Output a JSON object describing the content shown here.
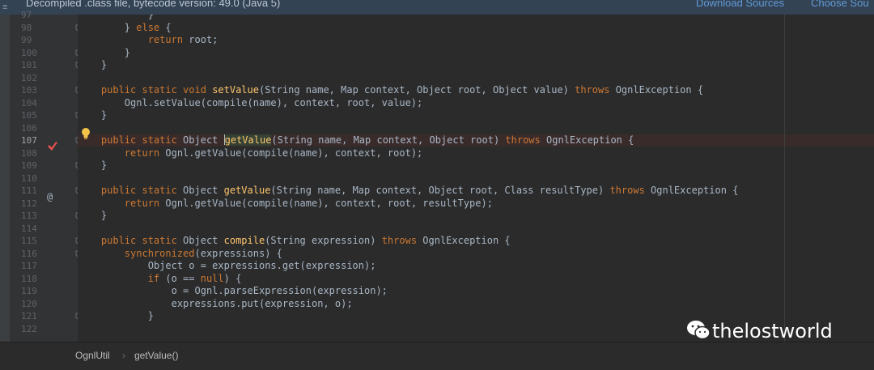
{
  "banner": {
    "title": "Decompiled .class file, bytecode version: 49.0 (Java 5)",
    "download_sources": "Download Sources",
    "choose_sources": "Choose Sou"
  },
  "editor": {
    "lines": [
      {
        "n": "97",
        "segs": [
          {
            "t": "            }",
            "c": "p"
          }
        ]
      },
      {
        "n": "98",
        "segs": [
          {
            "t": "        } ",
            "c": "p"
          },
          {
            "t": "else",
            "c": "kw"
          },
          {
            "t": " {",
            "c": "p"
          }
        ]
      },
      {
        "n": "99",
        "segs": [
          {
            "t": "            ",
            "c": "p"
          },
          {
            "t": "return",
            "c": "kw"
          },
          {
            "t": " root;",
            "c": "p"
          }
        ]
      },
      {
        "n": "100",
        "segs": [
          {
            "t": "        }",
            "c": "p"
          }
        ]
      },
      {
        "n": "101",
        "segs": [
          {
            "t": "    }",
            "c": "p"
          }
        ]
      },
      {
        "n": "102",
        "segs": []
      },
      {
        "n": "103",
        "segs": [
          {
            "t": "    ",
            "c": "p"
          },
          {
            "t": "public static void",
            "c": "kw"
          },
          {
            "t": " ",
            "c": "p"
          },
          {
            "t": "setValue",
            "c": "fn"
          },
          {
            "t": "(String name, Map context, Object root, Object value) ",
            "c": "p"
          },
          {
            "t": "throws",
            "c": "kw"
          },
          {
            "t": " OgnlException {",
            "c": "p"
          }
        ]
      },
      {
        "n": "104",
        "segs": [
          {
            "t": "        Ognl.setValue(compile(name), context, root, value);",
            "c": "p"
          }
        ]
      },
      {
        "n": "105",
        "segs": [
          {
            "t": "    }",
            "c": "p"
          }
        ]
      },
      {
        "n": "106",
        "segs": []
      },
      {
        "n": "107",
        "hl": true,
        "segs": [
          {
            "t": "    ",
            "c": "p"
          },
          {
            "t": "public static",
            "c": "kw"
          },
          {
            "t": " Object ",
            "c": "p"
          },
          {
            "t": "caret",
            "c": "caret"
          },
          {
            "t": "getValue",
            "c": "cur"
          },
          {
            "t": "(String name, Map context, Object root) ",
            "c": "p"
          },
          {
            "t": "throws",
            "c": "kw"
          },
          {
            "t": " OgnlException {",
            "c": "p"
          }
        ]
      },
      {
        "n": "108",
        "segs": [
          {
            "t": "        ",
            "c": "p"
          },
          {
            "t": "return",
            "c": "kw"
          },
          {
            "t": " Ognl.getValue(compile(name), context, root);",
            "c": "p"
          }
        ]
      },
      {
        "n": "109",
        "segs": [
          {
            "t": "    }",
            "c": "p"
          }
        ]
      },
      {
        "n": "110",
        "segs": []
      },
      {
        "n": "111",
        "segs": [
          {
            "t": "    ",
            "c": "p"
          },
          {
            "t": "public static",
            "c": "kw"
          },
          {
            "t": " Object ",
            "c": "p"
          },
          {
            "t": "getValue",
            "c": "fn"
          },
          {
            "t": "(String name, Map context, Object root, Class resultType) ",
            "c": "p"
          },
          {
            "t": "throws",
            "c": "kw"
          },
          {
            "t": " OgnlException {",
            "c": "p"
          }
        ]
      },
      {
        "n": "112",
        "segs": [
          {
            "t": "        ",
            "c": "p"
          },
          {
            "t": "return",
            "c": "kw"
          },
          {
            "t": " Ognl.getValue(compile(name), context, root, resultType);",
            "c": "p"
          }
        ]
      },
      {
        "n": "113",
        "segs": [
          {
            "t": "    }",
            "c": "p"
          }
        ]
      },
      {
        "n": "114",
        "segs": []
      },
      {
        "n": "115",
        "segs": [
          {
            "t": "    ",
            "c": "p"
          },
          {
            "t": "public static",
            "c": "kw"
          },
          {
            "t": " Object ",
            "c": "p"
          },
          {
            "t": "compile",
            "c": "fn"
          },
          {
            "t": "(String expression) ",
            "c": "p"
          },
          {
            "t": "throws",
            "c": "kw"
          },
          {
            "t": " OgnlException {",
            "c": "p"
          }
        ]
      },
      {
        "n": "116",
        "segs": [
          {
            "t": "        ",
            "c": "p"
          },
          {
            "t": "synchronized",
            "c": "kw"
          },
          {
            "t": "(expressions) {",
            "c": "p"
          }
        ]
      },
      {
        "n": "117",
        "segs": [
          {
            "t": "            Object o = expressions.get(expression);",
            "c": "p"
          }
        ]
      },
      {
        "n": "118",
        "segs": [
          {
            "t": "            ",
            "c": "p"
          },
          {
            "t": "if",
            "c": "kw"
          },
          {
            "t": " (o == ",
            "c": "p"
          },
          {
            "t": "null",
            "c": "kw"
          },
          {
            "t": ") {",
            "c": "p"
          }
        ]
      },
      {
        "n": "119",
        "segs": [
          {
            "t": "                o = Ognl.parseExpression(expression);",
            "c": "p"
          }
        ]
      },
      {
        "n": "120",
        "segs": [
          {
            "t": "                expressions.put(expression, o);",
            "c": "p"
          }
        ]
      },
      {
        "n": "121",
        "segs": [
          {
            "t": "            }",
            "c": "p"
          }
        ]
      },
      {
        "n": "122",
        "segs": []
      }
    ]
  },
  "gutter": {
    "override_marker": "@"
  },
  "status": {
    "class_name": "OgnlUtil",
    "method_name": "getValue()"
  },
  "watermark": {
    "text": "thelostworld"
  },
  "colors": {
    "keyword": "#cc7832",
    "function": "#ffc66d",
    "plain": "#a9b7c6",
    "background": "#2b2b2b",
    "banner": "#344354",
    "link": "#5f9bd8"
  },
  "icons": [
    "intention-bulb-icon",
    "breakpoint-icon",
    "fold-icon",
    "wechat-icon"
  ]
}
